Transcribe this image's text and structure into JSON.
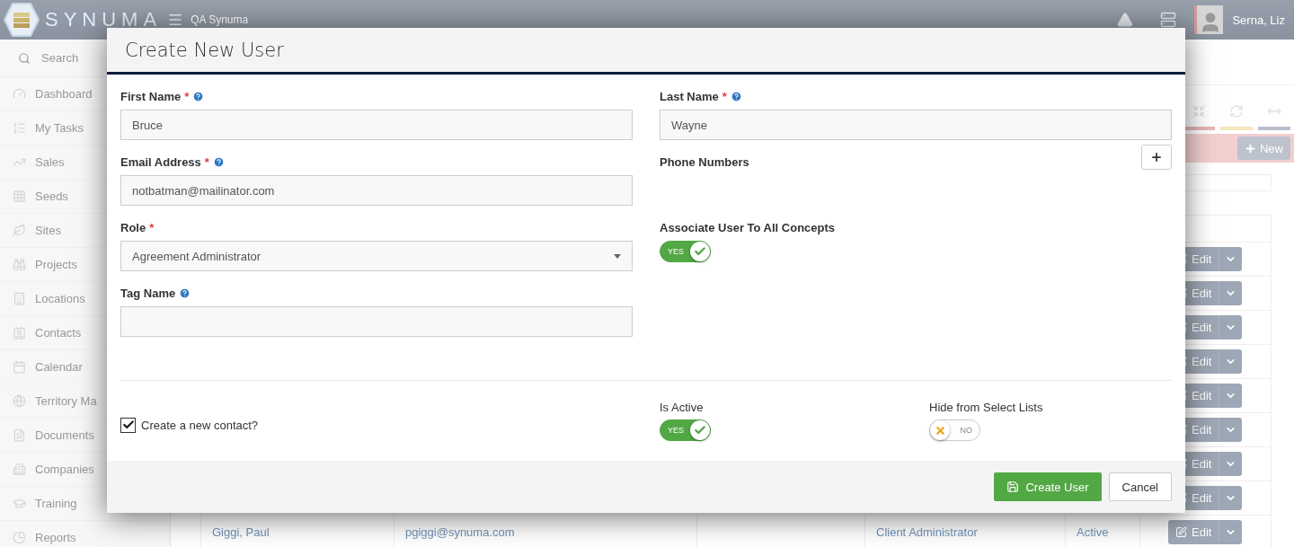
{
  "header": {
    "logo_text": "SYNUMA",
    "org": "QA Synuma",
    "user": "Serna, Liz"
  },
  "sidebar": {
    "search": {
      "placeholder": "Search"
    },
    "items": [
      {
        "label": "Dashboard",
        "kind": "gauge"
      },
      {
        "label": "My Tasks",
        "kind": "list"
      },
      {
        "label": "Sales",
        "kind": "chart"
      },
      {
        "label": "Seeds",
        "kind": "grid"
      },
      {
        "label": "Sites",
        "kind": "leaf"
      },
      {
        "label": "Projects",
        "kind": "binoculars"
      },
      {
        "label": "Locations",
        "kind": "building"
      },
      {
        "label": "Contacts",
        "kind": "contact"
      },
      {
        "label": "Calendar",
        "kind": "calendar"
      },
      {
        "label": "Territory Ma",
        "kind": "globe"
      },
      {
        "label": "Documents",
        "kind": "file"
      },
      {
        "label": "Companies",
        "kind": "office"
      },
      {
        "label": "Training",
        "kind": "cap"
      },
      {
        "label": "Reports",
        "kind": "pie"
      }
    ]
  },
  "toolbar": {
    "tools": [
      {
        "kind": "compress",
        "color": "#e6b6b6"
      },
      {
        "kind": "refresh",
        "color": "#f5e6bf"
      },
      {
        "kind": "width",
        "color": "#b8bfcb"
      }
    ],
    "new_button": "New"
  },
  "table": {
    "rows": [
      {
        "action": "Edit"
      },
      {
        "action": "Edit"
      },
      {
        "action": "Edit"
      },
      {
        "action": "Edit"
      },
      {
        "action": "Edit"
      },
      {
        "action": "Edit"
      },
      {
        "action": "Edit"
      },
      {
        "action": "Edit"
      },
      {
        "cells": [
          "Giggi, Paul",
          "pgiggi@synuma.com",
          "",
          "Client Administrator",
          "Active"
        ],
        "action": "Edit"
      }
    ]
  },
  "modal": {
    "title": "Create New User",
    "left_fields": [
      {
        "kind": "text",
        "label": "First Name",
        "required_mark": "*",
        "help": true,
        "value": "Bruce"
      },
      {
        "kind": "text",
        "label": "Email Address",
        "required_mark": "*",
        "help": true,
        "value": "notbatman@mailinator.com"
      },
      {
        "kind": "select",
        "label": "Role",
        "required_mark": "*",
        "help": false,
        "value": "Agreement Administrator"
      },
      {
        "kind": "text",
        "label": "Tag Name",
        "help": true
      }
    ],
    "right_fields": [
      {
        "kind": "text",
        "label": "Last Name",
        "required_mark": "*",
        "help": true,
        "value": "Wayne"
      },
      {
        "kind": "phones",
        "label": "Phone Numbers",
        "help": false
      },
      {
        "kind": "toggle",
        "label": "Associate User To All Concepts",
        "help": false,
        "on": true,
        "text": "YES"
      }
    ],
    "create_contact": {
      "label": "Create a new contact?",
      "checked": true
    },
    "is_active": {
      "label": "Is Active",
      "on": true,
      "text": "YES"
    },
    "hide_from_lists": {
      "label": "Hide from Select Lists",
      "on": false,
      "text": "NO"
    },
    "buttons": {
      "create": "Create User",
      "cancel": "Cancel"
    }
  }
}
